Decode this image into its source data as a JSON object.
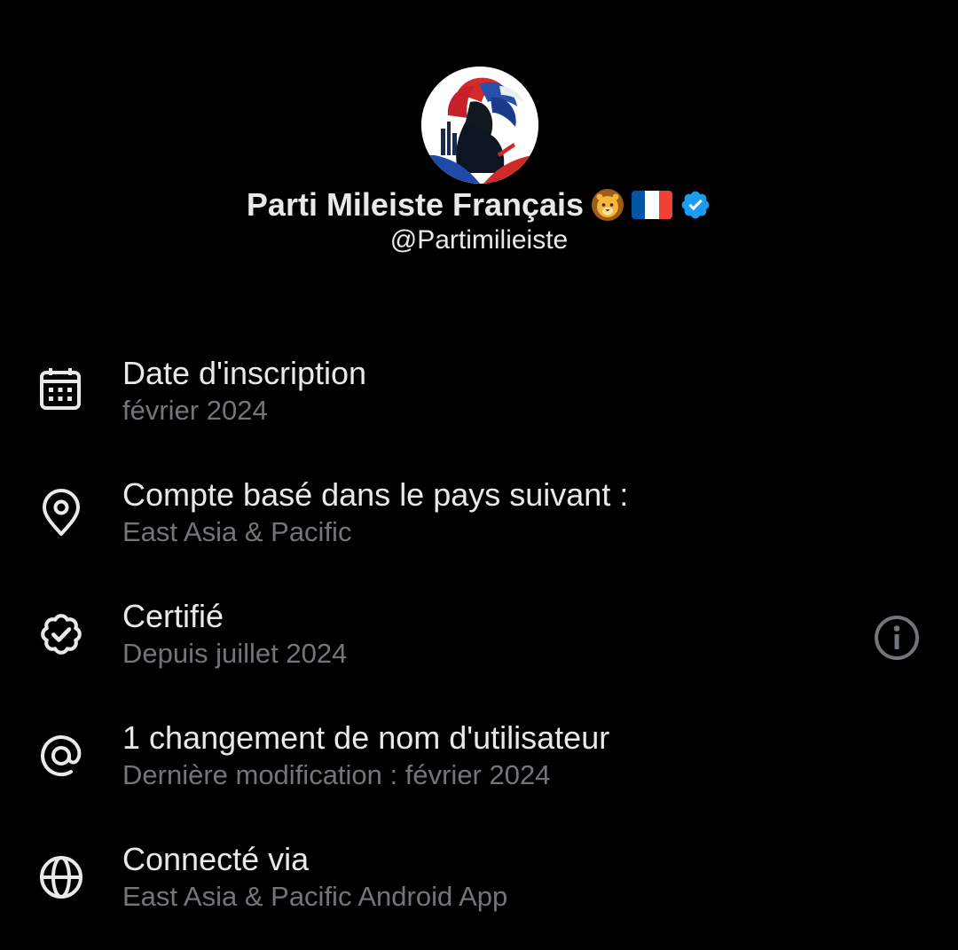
{
  "profile": {
    "display_name": "Parti Mileiste Français",
    "handle": "@Partimilieiste",
    "badges": [
      "lion-emoji",
      "france-flag-emoji",
      "verified-badge-icon"
    ],
    "verified_color": "#1d9bf0",
    "flag_colors": [
      "#0055a4",
      "#ffffff",
      "#ef4135"
    ]
  },
  "info": {
    "joined": {
      "icon": "calendar-icon",
      "title": "Date d'inscription",
      "value": "février 2024"
    },
    "location": {
      "icon": "location-pin-icon",
      "title": "Compte basé dans le pays suivant :",
      "value": "East Asia & Pacific"
    },
    "verified": {
      "icon": "verified-badge-outline-icon",
      "title": "Certifié",
      "value": "Depuis juillet 2024",
      "action_icon": "info-icon"
    },
    "username_changes": {
      "icon": "at-sign-icon",
      "title": "1 changement de nom d'utilisateur",
      "value": "Dernière modification : février 2024"
    },
    "connected_via": {
      "icon": "globe-icon",
      "title": "Connecté via",
      "value": "East Asia & Pacific Android App"
    }
  },
  "theme": {
    "background": "#000000",
    "primary_text": "#e7e9ea",
    "secondary_text": "#71767b"
  }
}
